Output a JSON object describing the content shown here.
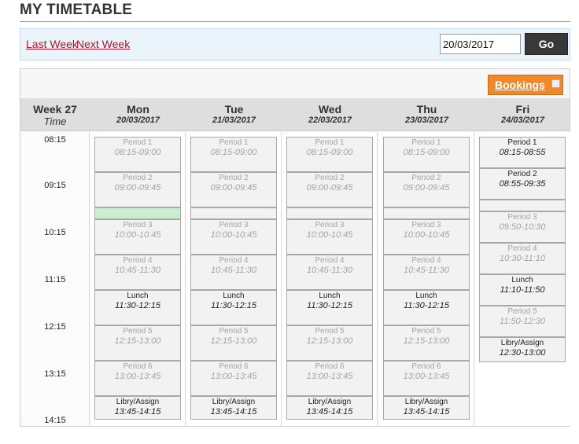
{
  "page": {
    "title": "MY TIMETABLE"
  },
  "nav": {
    "last_week": "Last Week",
    "next_week": "Next Week",
    "date_value": "20/03/2017",
    "go_label": "Go"
  },
  "bookings": {
    "label": "Bookings"
  },
  "header": {
    "week": "Week 27",
    "time": "Time",
    "days": [
      {
        "name": "Mon",
        "date": "20/03/2017"
      },
      {
        "name": "Tue",
        "date": "21/03/2017"
      },
      {
        "name": "Wed",
        "date": "22/03/2017"
      },
      {
        "name": "Thu",
        "date": "23/03/2017"
      },
      {
        "name": "Fri",
        "date": "24/03/2017"
      }
    ]
  },
  "times": [
    "08:15",
    "09:15",
    "10:15",
    "11:15",
    "12:15",
    "13:15",
    "14:15"
  ],
  "schedules": {
    "standard": [
      {
        "name": "Period 1",
        "time": "08:15-09:00",
        "active": false
      },
      {
        "name": "Period 2",
        "time": "09:00-09:45",
        "active": false
      },
      {
        "name": "",
        "time": "",
        "active": false
      },
      {
        "name": "Period 3",
        "time": "10:00-10:45",
        "active": false
      },
      {
        "name": "Period 4",
        "time": "10:45-11:30",
        "active": false
      },
      {
        "name": "Lunch",
        "time": "11:30-12:15",
        "active": true
      },
      {
        "name": "Period 5",
        "time": "12:15-13:00",
        "active": false
      },
      {
        "name": "Period 6",
        "time": "13:00-13:45",
        "active": false
      },
      {
        "name": "Libry/Assign",
        "time": "13:45-14:15",
        "active": true
      }
    ],
    "friday": [
      {
        "name": "Period 1",
        "time": "08:15-08:55",
        "active": true
      },
      {
        "name": "Period 2",
        "time": "08:55-09:35",
        "active": true
      },
      {
        "name": "",
        "time": "",
        "active": false
      },
      {
        "name": "Period 3",
        "time": "09:50-10:30",
        "active": false
      },
      {
        "name": "Period 4",
        "time": "10:30-11:10",
        "active": false
      },
      {
        "name": "Lunch",
        "time": "11:10-11:50",
        "active": true
      },
      {
        "name": "Period 5",
        "time": "11:50-12:30",
        "active": false
      },
      {
        "name": "Libry/Assign",
        "time": "12:30-13:00",
        "active": true
      }
    ]
  },
  "highlight": {
    "color": "#c8f0cf",
    "day_index": 0
  }
}
